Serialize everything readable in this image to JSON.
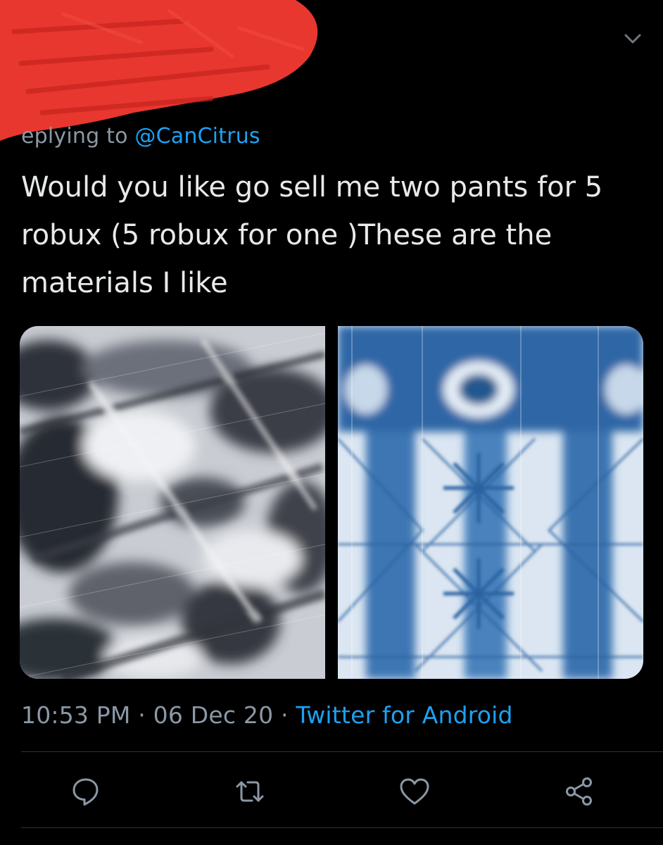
{
  "reply": {
    "prefix": "eplying to",
    "mention": "@CanCitrus"
  },
  "tweet": {
    "text": "Would you like go sell me two pants for 5 robux (5 robux for one )These are the materials I like"
  },
  "media": [
    {
      "description": "black and white tie-dye fabric"
    },
    {
      "description": "blue shibori tie-dye fabric"
    }
  ],
  "meta": {
    "time": "10:53 PM",
    "sep1": " · ",
    "date": "06 Dec 20",
    "sep2": " · ",
    "source": "Twitter for Android"
  },
  "actions": [
    {
      "icon": "reply-icon"
    },
    {
      "icon": "retweet-icon"
    },
    {
      "icon": "like-icon"
    },
    {
      "icon": "share-icon"
    }
  ],
  "colors": {
    "background": "#000000",
    "text": "#e7e9ea",
    "secondary": "#8b98a5",
    "link": "#1da1f2",
    "redaction": "#e8372f"
  }
}
